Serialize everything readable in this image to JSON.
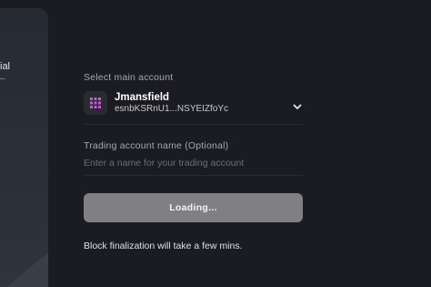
{
  "side_panel": {
    "text_line1": "ial",
    "text_line2": "–"
  },
  "form": {
    "main_account_label": "Select main account",
    "account": {
      "name": "Jmansfield",
      "address": "esnbKSRnU1...NSYEIZfoYc",
      "avatar_icon": "grid-dots-icon",
      "avatar_color": "#c45ad8"
    },
    "trading_name_label": "Trading account name (Optional)",
    "trading_name_placeholder": "Enter a name for your trading account",
    "trading_name_value": "",
    "submit_label": "Loading...",
    "note": "Block finalization will take a few mins."
  }
}
